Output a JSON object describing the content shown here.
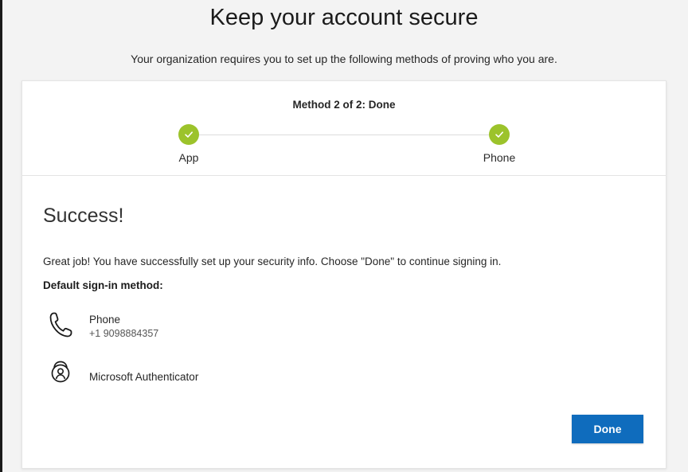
{
  "header": {
    "title": "Keep your account secure",
    "subtitle": "Your organization requires you to set up the following methods of proving who you are."
  },
  "progress": {
    "caption": "Method 2 of 2: Done",
    "steps": [
      {
        "label": "App",
        "status": "complete"
      },
      {
        "label": "Phone",
        "status": "complete"
      }
    ],
    "complete_color": "#9cc32b"
  },
  "content": {
    "heading": "Success!",
    "message": "Great job! You have successfully set up your security info. Choose \"Done\" to continue signing in.",
    "default_method_label": "Default sign-in method:",
    "methods": [
      {
        "icon": "phone-icon",
        "name": "Phone",
        "detail": "+1 9098884357"
      },
      {
        "icon": "authenticator-icon",
        "name": "Microsoft Authenticator"
      }
    ]
  },
  "actions": {
    "done_label": "Done",
    "done_color": "#0f6cbd"
  }
}
